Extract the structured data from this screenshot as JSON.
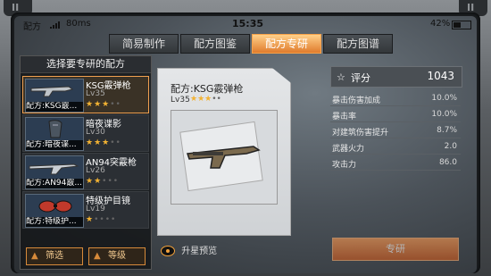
{
  "status_bar": {
    "carrier": "配方",
    "ping": "80ms",
    "time": "15:35",
    "battery_pct": "42%",
    "battery_level": 0.42
  },
  "tabs": [
    {
      "label": "简易制作",
      "active": false
    },
    {
      "label": "配方图鉴",
      "active": false
    },
    {
      "label": "配方专研",
      "active": true
    },
    {
      "label": "配方图谱",
      "active": false
    }
  ],
  "left_panel": {
    "title": "选择要专研的配方",
    "items": [
      {
        "name": "KSG霰弹枪",
        "level": "Lv35",
        "stars": 3,
        "max_stars": 5,
        "tag": "配方:KSG霰...",
        "selected": true
      },
      {
        "name": "暗夜谍影",
        "level": "Lv30",
        "stars": 3,
        "max_stars": 5,
        "tag": "配方:暗夜谍...",
        "selected": false
      },
      {
        "name": "AN94突霰枪",
        "level": "Lv26",
        "stars": 2,
        "max_stars": 5,
        "tag": "配方:AN94霰...",
        "selected": false
      },
      {
        "name": "特级护目镜",
        "level": "Lv19",
        "stars": 1,
        "max_stars": 5,
        "tag": "配方:特级护...",
        "selected": false
      }
    ],
    "filter_label": "筛选",
    "level_sort_label": "等级"
  },
  "detail": {
    "title": "配方:KSG霰弹枪",
    "level": "Lv35",
    "stars": 3,
    "max_stars": 5,
    "preview_label": "升星预览"
  },
  "stats": {
    "score_label": "评分",
    "score_value": "1043",
    "attributes": [
      {
        "key": "暴击伤害加成",
        "value": "10.0%"
      },
      {
        "key": "暴击率",
        "value": "10.0%"
      },
      {
        "key": "对建筑伤害提升",
        "value": "8.7%"
      },
      {
        "key": "武器火力",
        "value": "2.0"
      },
      {
        "key": "攻击力",
        "value": "86.0"
      }
    ]
  },
  "craft_button_label": "专研",
  "icons": {
    "eye": "eye-icon",
    "score": "score-icon",
    "sort_arrow": "arrow-up-icon",
    "signal": "signal-icon",
    "battery": "battery-icon"
  },
  "colors": {
    "accent": "#e07c2d",
    "star": "#f2b233",
    "selected_border": "#f0a050"
  }
}
